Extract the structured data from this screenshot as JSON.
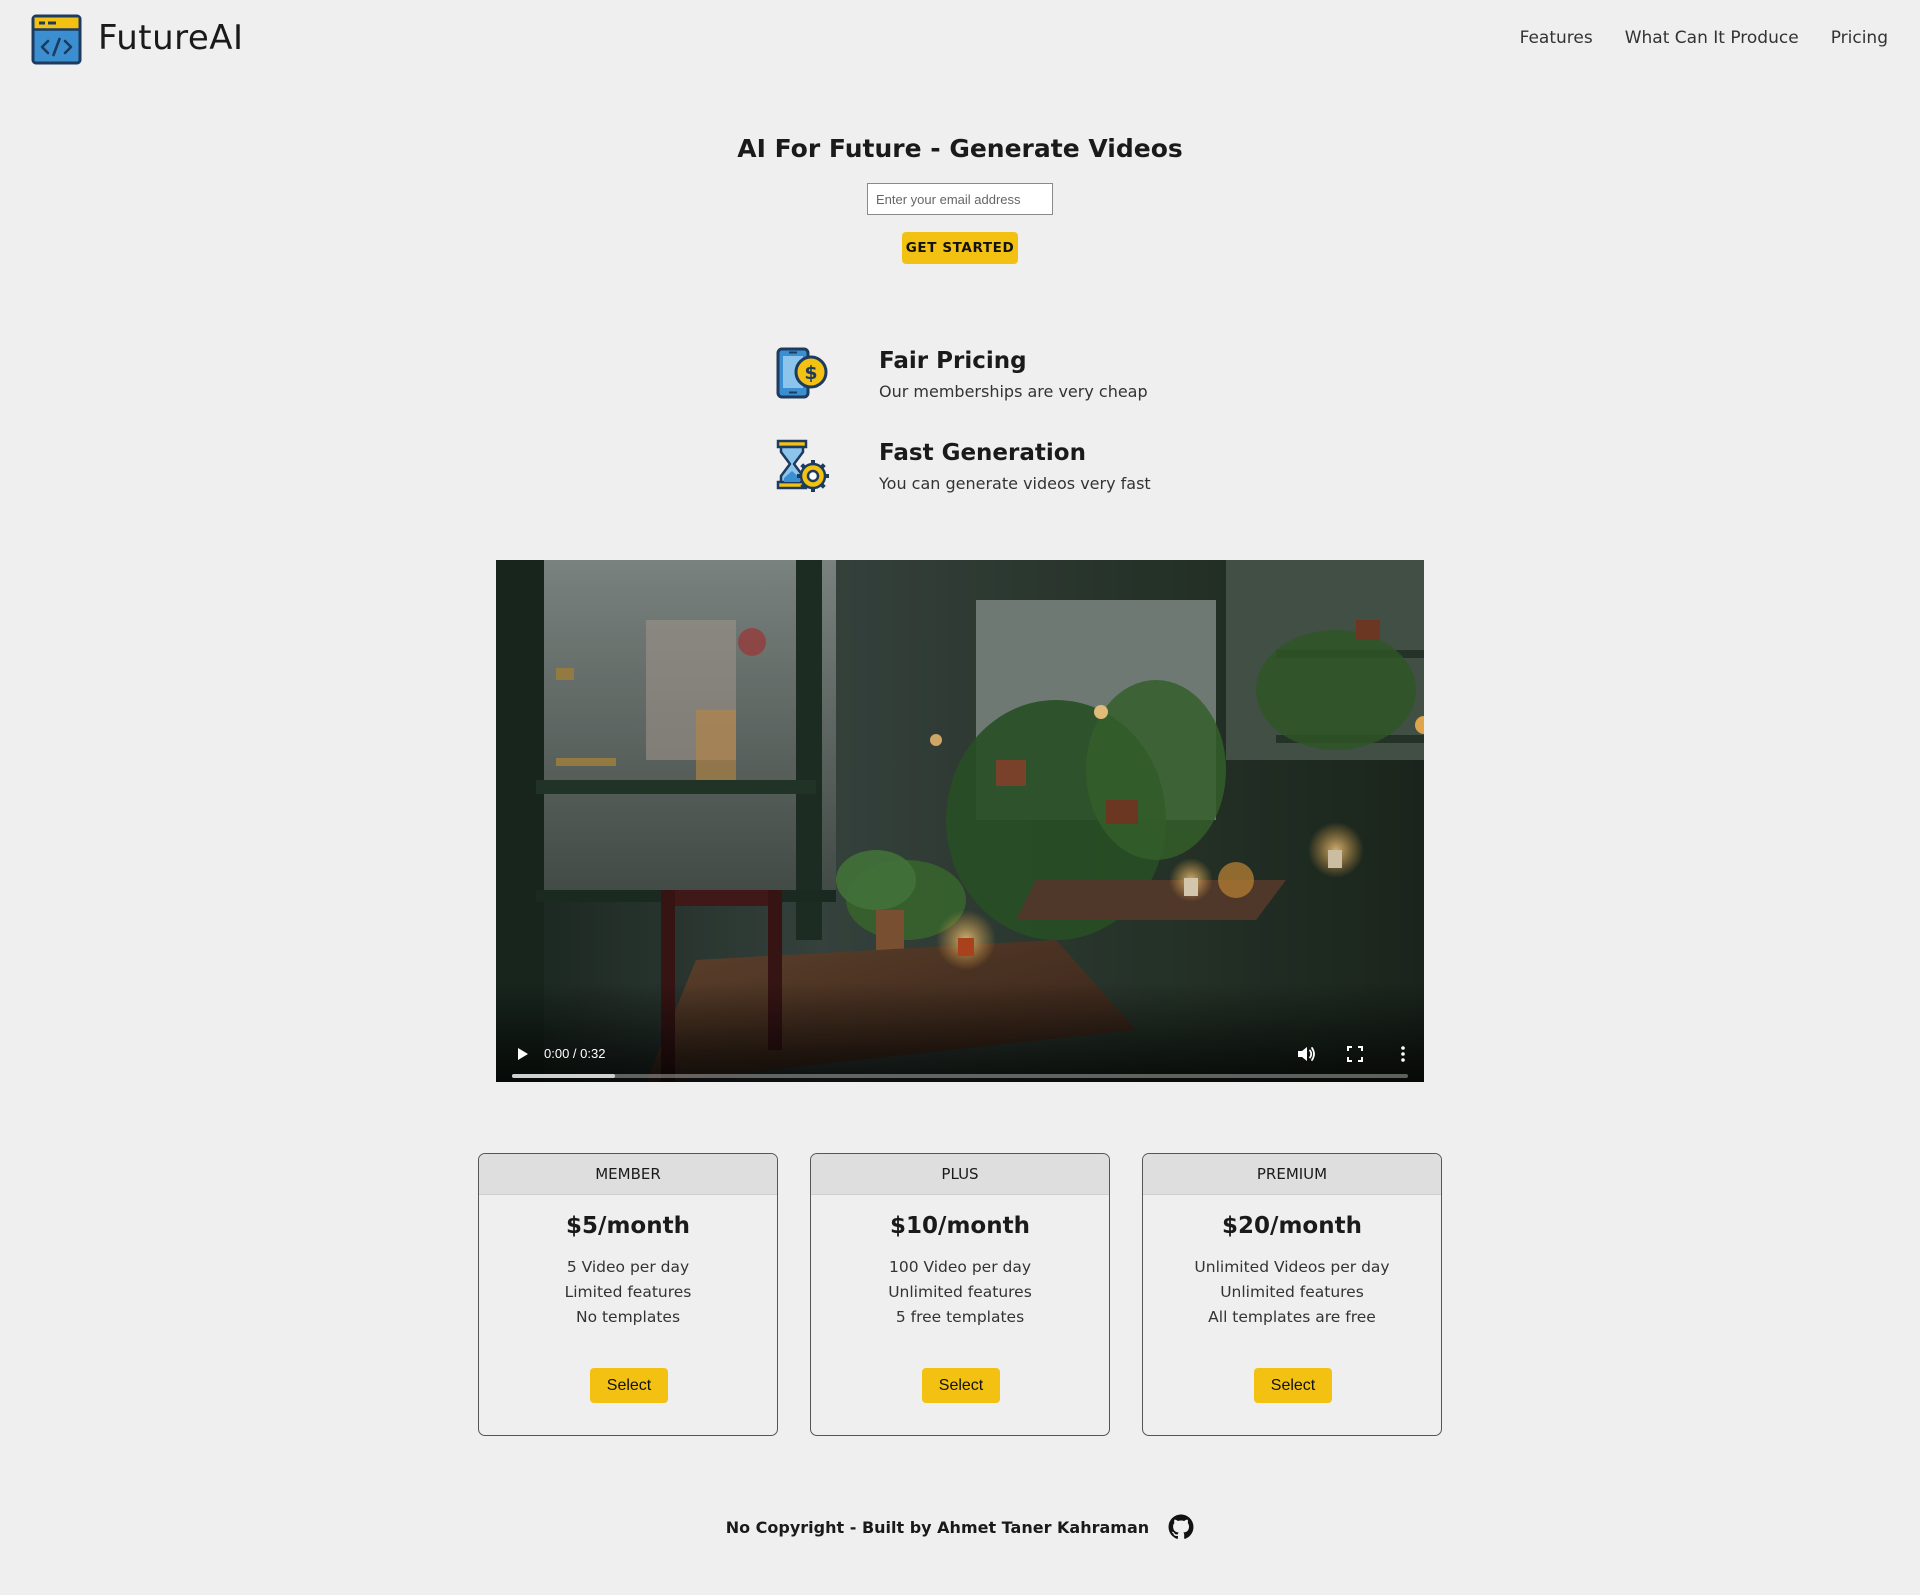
{
  "header": {
    "brand": "FutureAI",
    "nav": [
      "Features",
      "What Can It Produce",
      "Pricing"
    ]
  },
  "hero": {
    "title": "AI For Future - Generate Videos",
    "email_placeholder": "Enter your email address",
    "cta": "GET STARTED"
  },
  "features": [
    {
      "title": "Fair Pricing",
      "description": "Our memberships are very cheap",
      "icon": "mobile-dollar-icon"
    },
    {
      "title": "Fast Generation",
      "description": "You can generate videos very fast",
      "icon": "hourglass-gear-icon"
    }
  ],
  "video": {
    "time": "0:00 / 0:32",
    "buffered_fraction": 0.115
  },
  "pricing": [
    {
      "name": "MEMBER",
      "price": "$5/month",
      "features": [
        "5 Video per day",
        "Limited features",
        "No templates"
      ],
      "button": "Select"
    },
    {
      "name": "PLUS",
      "price": "$10/month",
      "features": [
        "100 Video per day",
        "Unlimited features",
        "5 free templates"
      ],
      "button": "Select"
    },
    {
      "name": "PREMIUM",
      "price": "$20/month",
      "features": [
        "Unlimited Videos per day",
        "Unlimited features",
        "All templates are free"
      ],
      "button": "Select"
    }
  ],
  "footer": {
    "text": "No Copyright - Built by Ahmet Taner Kahraman"
  },
  "colors": {
    "background": "#efefef",
    "accent": "#f3c112",
    "icon_blue": "#3b8fd0",
    "icon_outline": "#1d3a5f"
  }
}
